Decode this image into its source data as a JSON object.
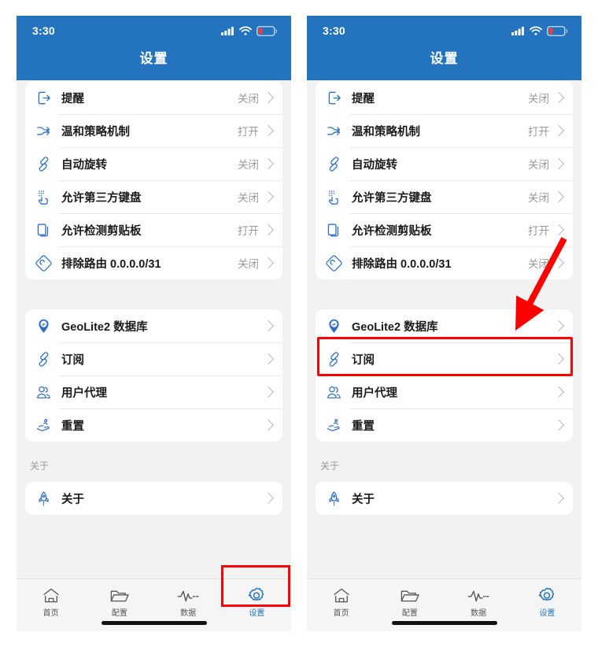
{
  "status_bar": {
    "time": "3:30",
    "icons": [
      "cellular-signal-icon",
      "wifi-icon",
      "battery-low-icon"
    ]
  },
  "nav": {
    "title": "设置"
  },
  "groups": [
    {
      "id": "group1",
      "rows": [
        {
          "icon": "exit-arrow-icon",
          "label": "提醒",
          "value": "关闭"
        },
        {
          "icon": "shuffle-icon",
          "label": "温和策略机制",
          "value": "打开"
        },
        {
          "icon": "link-chain-icon",
          "label": "自动旋转",
          "value": "关闭"
        },
        {
          "icon": "keyboard-hand-icon",
          "label": "允许第三方键盘",
          "value": "关闭"
        },
        {
          "icon": "clipboard-copy-icon",
          "label": "允许检测剪贴板",
          "value": "打开"
        },
        {
          "icon": "route-diamond-icon",
          "label": "排除路由 0.0.0.0/31",
          "value": "关闭"
        }
      ]
    },
    {
      "id": "group2",
      "rows": [
        {
          "icon": "ip-pin-icon",
          "label": "GeoLite2 数据库",
          "value": ""
        },
        {
          "icon": "link-chain-icon",
          "label": "订阅",
          "value": ""
        },
        {
          "icon": "user-agent-icon",
          "label": "用户代理",
          "value": ""
        },
        {
          "icon": "reset-hand-icon",
          "label": "重置",
          "value": ""
        }
      ]
    },
    {
      "id": "group3",
      "header": "关于",
      "rows": [
        {
          "icon": "rocket-icon",
          "label": "关于",
          "value": ""
        }
      ]
    }
  ],
  "tabbar": {
    "tabs": [
      {
        "icon": "home-icon",
        "label": "首页",
        "active": false
      },
      {
        "icon": "folder-icon",
        "label": "配置",
        "active": false
      },
      {
        "icon": "pulse-icon",
        "label": "数据",
        "active": false
      },
      {
        "icon": "gear-icon",
        "label": "设置",
        "active": true
      }
    ]
  },
  "annotations": {
    "highlight_color": "#fe0000",
    "left_panel_highlight": "tab-settings",
    "right_panel_highlight": "row-subscription",
    "arrow": "points-to-subscription-row"
  },
  "theme": {
    "header_blue": "#2373be",
    "accent_blue": "#2373be",
    "page_bg": "#f2f2f2",
    "card_bg": "#ffffff",
    "value_grey": "#9a9a9a"
  }
}
